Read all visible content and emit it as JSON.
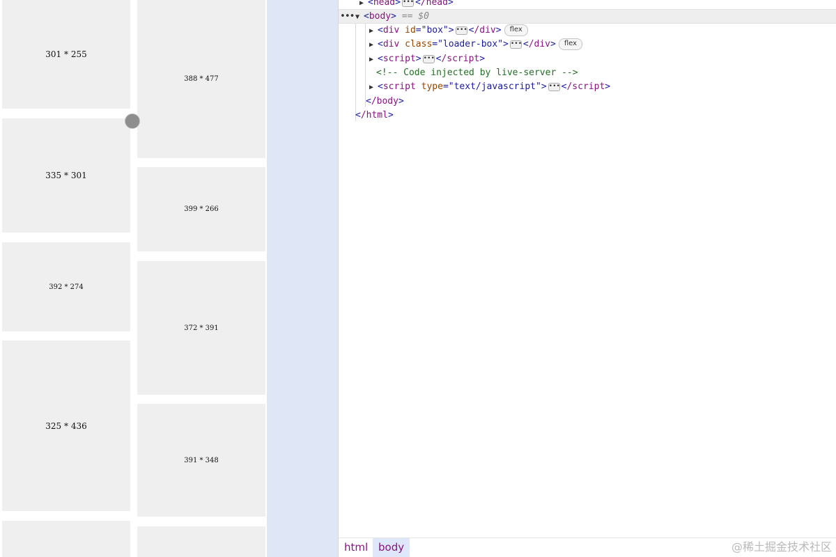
{
  "preview": {
    "left_column": [
      "301 * 255",
      "335 * 301",
      "392 * 274",
      "325 * 436",
      ""
    ],
    "right_column": [
      "388 * 477",
      "399 * 266",
      "372 * 391",
      "391 * 348",
      ""
    ]
  },
  "devtools": {
    "lines": [
      {
        "head_tag": "head",
        "head_close": "/head"
      },
      {
        "body_tag": "body",
        "eq": "== $0"
      },
      {
        "tag": "div",
        "attr_name": "id",
        "attr_value": "\"box\"",
        "close": "/div",
        "badge": "flex"
      },
      {
        "tag": "div",
        "attr_name": "class",
        "attr_value": "\"loader-box\"",
        "close": "/div",
        "badge": "flex"
      },
      {
        "tag": "script",
        "close": "/script"
      },
      {
        "comment": "<!-- Code injected by live-server -->"
      },
      {
        "tag": "script",
        "attr_name": "type",
        "attr_value": "\"text/javascript\"",
        "close": "/script"
      },
      {
        "close_body": "/body"
      },
      {
        "close_html": "/html"
      }
    ],
    "dots": "•••",
    "ellipsis": "•••"
  },
  "breadcrumb": [
    "html",
    "body"
  ],
  "watermark": "@稀土掘金技术社区",
  "colors": {
    "tag": "#881280",
    "attr_name": "#994500",
    "attr_value": "#1a1aa6",
    "comment": "#236e25",
    "card_bg": "#efefef",
    "gutter_bg": "#dfe6f5"
  }
}
